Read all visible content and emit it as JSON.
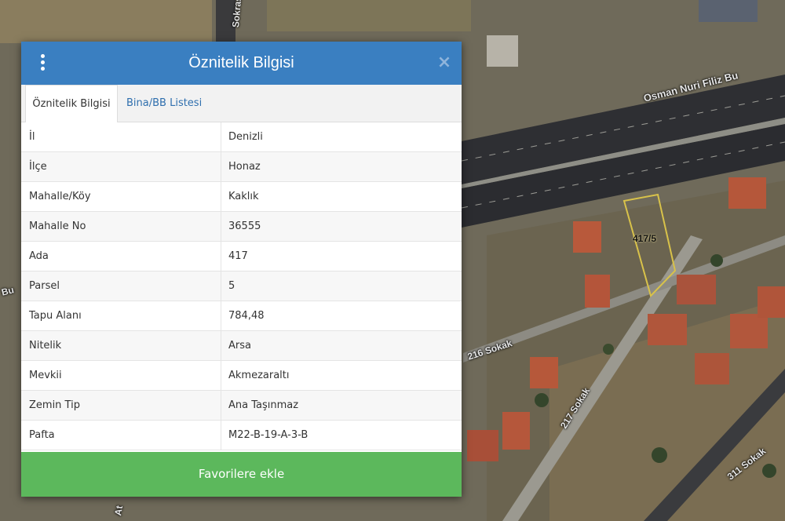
{
  "map": {
    "street_labels": [
      "Osman Nuri Filiz Bu",
      "216 Sokak",
      "217 Sokak",
      "311 Sokak",
      "Sokrası S",
      "Bu",
      "At"
    ],
    "parcel_label": "417/5",
    "parcel_outline_color": "#d8c24a"
  },
  "dialog": {
    "title": "Öznitelik Bilgisi",
    "menu_icon": "vertical-dots-icon",
    "close_icon": "close-icon",
    "close_glyph": "×",
    "header_color": "#3a7fc1",
    "tabs": [
      {
        "label": "Öznitelik Bilgisi",
        "active": true
      },
      {
        "label": "Bina/BB Listesi",
        "active": false
      }
    ],
    "rows": [
      {
        "key": "İl",
        "value": "Denizli"
      },
      {
        "key": "İlçe",
        "value": "Honaz"
      },
      {
        "key": "Mahalle/Köy",
        "value": "Kaklık"
      },
      {
        "key": "Mahalle No",
        "value": "36555"
      },
      {
        "key": "Ada",
        "value": "417"
      },
      {
        "key": "Parsel",
        "value": "5"
      },
      {
        "key": "Tapu Alanı",
        "value": "784,48"
      },
      {
        "key": "Nitelik",
        "value": "Arsa"
      },
      {
        "key": "Mevkii",
        "value": "Akmezaraltı"
      },
      {
        "key": "Zemin Tip",
        "value": "Ana Taşınmaz"
      },
      {
        "key": "Pafta",
        "value": "M22-B-19-A-3-B"
      }
    ],
    "favorite_button_label": "Favorilere ekle",
    "favorite_button_color": "#5cb85c"
  }
}
